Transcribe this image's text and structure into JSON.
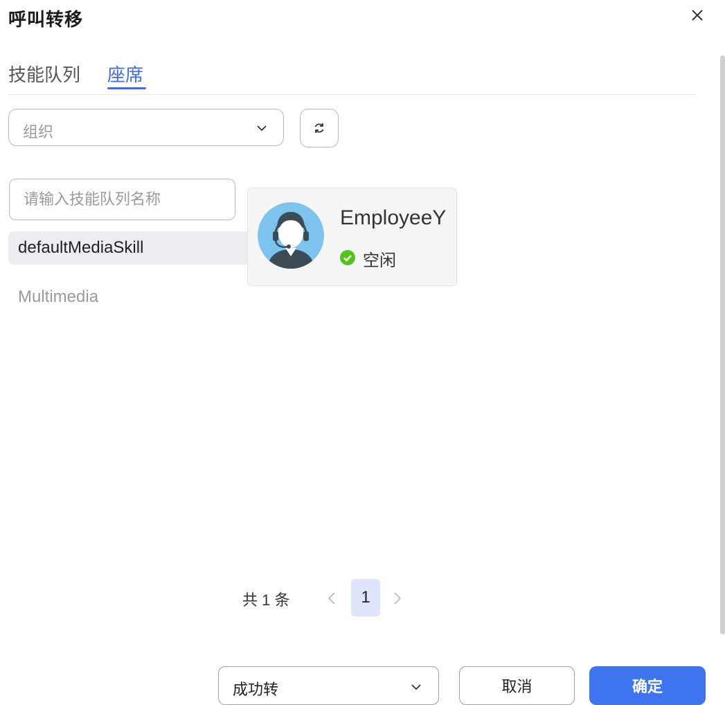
{
  "dialog": {
    "title": "呼叫转移",
    "close_icon": "close-icon"
  },
  "tabs": [
    {
      "label": "技能队列",
      "active": false
    },
    {
      "label": "座席",
      "active": true
    }
  ],
  "org_select": {
    "placeholder": "组织",
    "icon": "chevron-down-icon"
  },
  "refresh_icon": "refresh-icon",
  "skill_search": {
    "placeholder": "请输入技能队列名称",
    "value": ""
  },
  "skill_list": [
    {
      "label": "defaultMediaSkill",
      "selected": true
    },
    {
      "label": "Multimedia",
      "selected": false
    }
  ],
  "agents": [
    {
      "name": "EmployeeY",
      "status": "空闲",
      "status_color": "#52c41a",
      "avatar_icon": "agent-headset-avatar-icon"
    }
  ],
  "pagination": {
    "total_text": "共 1 条",
    "current_page": "1"
  },
  "footer": {
    "result_select_value": "成功转",
    "cancel_label": "取消",
    "confirm_label": "确定"
  },
  "colors": {
    "accent": "#3b6cf0",
    "confirm_bg": "#3f74f0",
    "page_active_bg": "#dfe6fb"
  }
}
